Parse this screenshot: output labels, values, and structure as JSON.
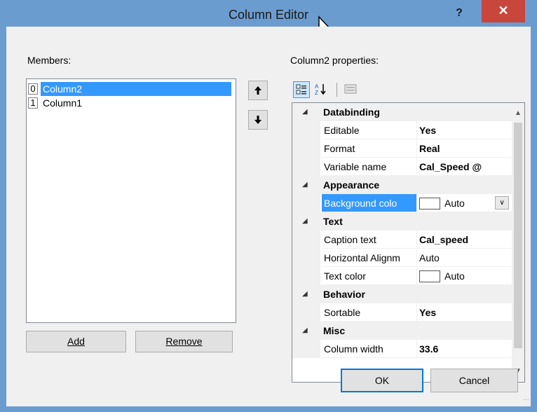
{
  "window": {
    "title": "Column Editor",
    "help": "?",
    "close": "✕"
  },
  "members": {
    "label": "Members:",
    "items": [
      {
        "index": "0",
        "name": "Column2",
        "selected": true
      },
      {
        "index": "1",
        "name": "Column1",
        "selected": false
      }
    ],
    "add_label": "Add",
    "remove_label": "Remove",
    "move_up": "↑",
    "move_down": "↓"
  },
  "properties": {
    "label": "Column2 properties:",
    "toolbar": {
      "categorized": "categorized-icon",
      "alphabetical": "sort-az-icon",
      "property_pages": "property-pages-icon"
    },
    "categories": [
      {
        "name": "Databinding",
        "props": [
          {
            "name": "Editable",
            "value": "Yes",
            "bold": true
          },
          {
            "name": "Format",
            "value": "Real",
            "bold": true
          },
          {
            "name": "Variable name",
            "value": "Cal_Speed @",
            "bold": true
          }
        ]
      },
      {
        "name": "Appearance",
        "props": [
          {
            "name": "Background colo",
            "value": "Auto",
            "swatch": true,
            "dropdown": true,
            "selected": true
          }
        ]
      },
      {
        "name": "Text",
        "props": [
          {
            "name": "Caption text",
            "value": "Cal_speed",
            "bold": true
          },
          {
            "name": "Horizontal Alignm",
            "value": "Auto"
          },
          {
            "name": "Text color",
            "value": "Auto",
            "swatch": true
          }
        ]
      },
      {
        "name": "Behavior",
        "props": [
          {
            "name": "Sortable",
            "value": "Yes",
            "bold": true
          }
        ]
      },
      {
        "name": "Misc",
        "props": [
          {
            "name": "Column width",
            "value": "33.6",
            "bold": true
          }
        ]
      }
    ]
  },
  "buttons": {
    "ok": "OK",
    "cancel": "Cancel"
  },
  "colors": {
    "titlebar": "#6b9cd0",
    "close": "#c9463d",
    "selection": "#3399ff"
  }
}
